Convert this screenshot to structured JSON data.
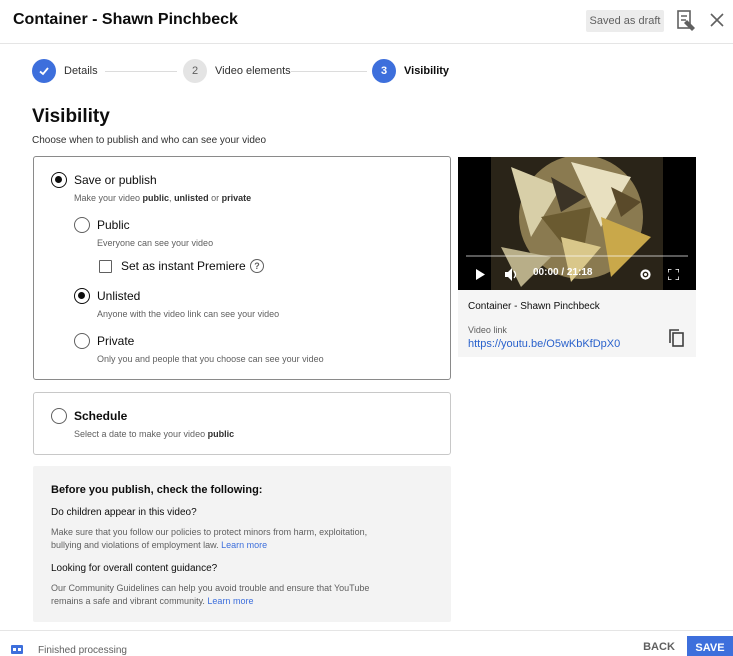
{
  "header": {
    "title": "Container - Shawn Pinchbeck",
    "draft_badge": "Saved as draft"
  },
  "stepper": {
    "steps": [
      {
        "number": "",
        "label": "Details",
        "state": "done"
      },
      {
        "number": "2",
        "label": "Video elements",
        "state": "pending"
      },
      {
        "number": "3",
        "label": "Visibility",
        "state": "active"
      }
    ]
  },
  "visibility": {
    "title": "Visibility",
    "subtitle": "Choose when to publish and who can see your video"
  },
  "publish": {
    "title": "Save or publish",
    "desc_prefix": "Make your video ",
    "desc_public": "public",
    "desc_sep1": ", ",
    "desc_unlisted": "unlisted",
    "desc_sep2": " or ",
    "desc_private": "private",
    "options": {
      "public": {
        "label": "Public",
        "desc": "Everyone can see your video",
        "checked": false
      },
      "premiere": {
        "label": "Set as instant Premiere",
        "help": "?",
        "checked": false
      },
      "unlisted": {
        "label": "Unlisted",
        "desc": "Anyone with the video link can see your video",
        "checked": true
      },
      "private": {
        "label": "Private",
        "desc": "Only you and people that you choose can see your video",
        "checked": false
      }
    },
    "selected": true
  },
  "schedule": {
    "title": "Schedule",
    "desc_prefix": "Select a date to make your video ",
    "desc_bold": "public",
    "selected": false
  },
  "checklist": {
    "title": "Before you publish, check the following:",
    "q1": "Do children appear in this video?",
    "q1_text": "Make sure that you follow our policies to protect minors from harm, exploitation, bullying and violations of employment law.",
    "q1_link": "Learn more",
    "q2": "Looking for overall content guidance?",
    "q2_text": "Our Community Guidelines can help you avoid trouble and ensure that YouTube remains a safe and vibrant community.",
    "q2_link": "Learn more"
  },
  "video": {
    "time": "00:00 / 21:18",
    "title": "Container - Shawn Pinchbeck",
    "link_label": "Video link",
    "link": "https://youtu.be/O5wKbKfDpX0"
  },
  "footer": {
    "status": "Finished processing",
    "back": "BACK",
    "save": "SAVE"
  },
  "colors": {
    "accent": "#3d6fdc",
    "link": "#2a62cc"
  }
}
